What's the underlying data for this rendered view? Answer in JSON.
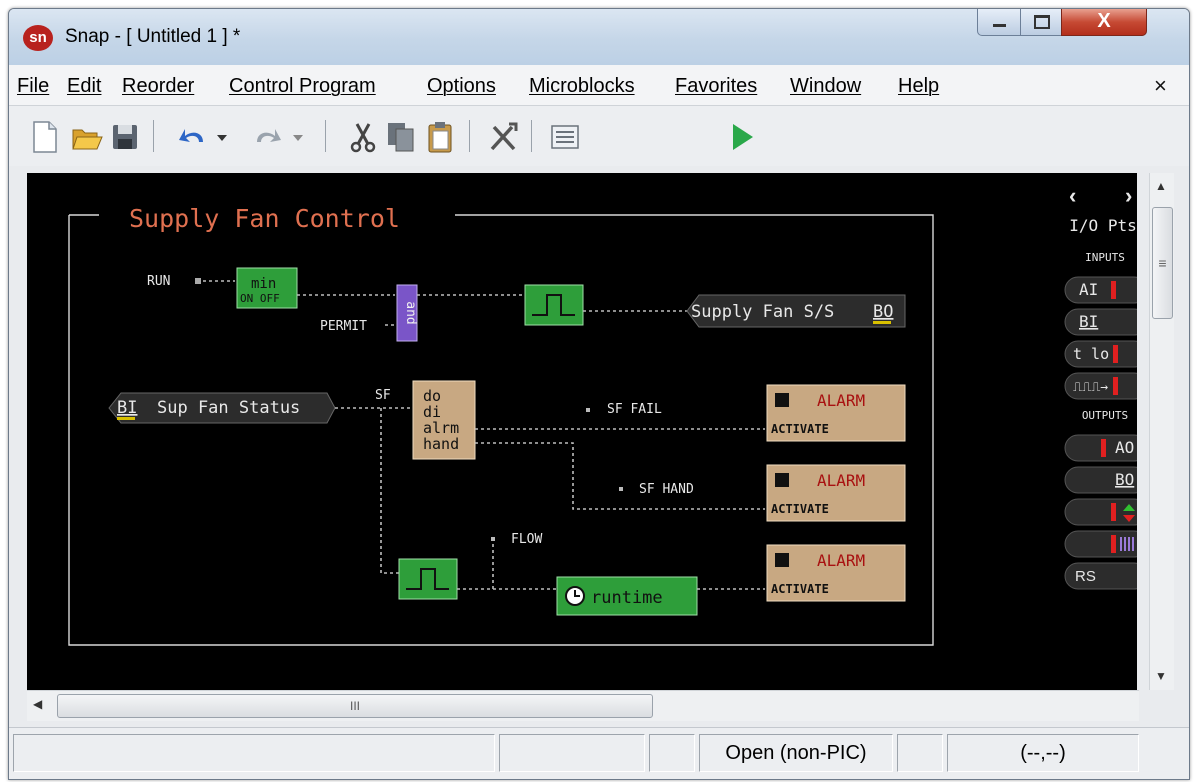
{
  "window": {
    "title": "Snap - [ Untitled 1 ] *",
    "app_icon": "sn",
    "close_glyph": "X"
  },
  "menu": {
    "items": [
      "File",
      "Edit",
      "Reorder",
      "Control Program",
      "Options",
      "Microblocks",
      "Favorites",
      "Window",
      "Help"
    ],
    "close": "×"
  },
  "toolbar": {
    "icons": [
      "new-file-icon",
      "open-folder-icon",
      "save-icon",
      "undo-icon",
      "redo-icon",
      "cut-icon",
      "copy-icon",
      "paste-icon",
      "tools-icon",
      "list-icon",
      "run-icon"
    ]
  },
  "diagram": {
    "title": "Supply Fan Control",
    "run": "RUN",
    "permit": "PERMIT",
    "min_top": "min",
    "min_bottom": "ON OFF",
    "and_label": "and",
    "supply_fan_out": "Supply Fan S/S",
    "supply_fan_out_type": "BO",
    "sf": "SF",
    "bi_type": "BI",
    "bi_name": "Sup Fan Status",
    "block_lines": [
      "do",
      "di",
      "alrm",
      "hand"
    ],
    "sf_fail": "SF FAIL",
    "sf_hand": "SF HAND",
    "flow": "FLOW",
    "runtime": "runtime",
    "alarm_label": "ALARM",
    "activate_label": "ACTIVATE"
  },
  "io_panel": {
    "prev": "‹",
    "next": "›",
    "title": "I/O Pts",
    "inputs_header": "INPUTS",
    "inputs": [
      "AI",
      "BI",
      "t lo",
      "⎍⎍⎍→"
    ],
    "outputs_header": "OUTPUTS",
    "outputs": [
      "AO",
      "BO",
      "",
      "",
      "RS"
    ]
  },
  "hscroll": {
    "thumb_grip": "III"
  },
  "vscroll": {
    "thumb_grip": "≡"
  },
  "status": {
    "mode": "Open (non-PIC)",
    "coords": "(--,--)"
  },
  "colors": {
    "alarm_text": "#a81010",
    "wire": "#c8c8c8",
    "title": "#e07050",
    "green_block": "#2e9e3a",
    "purple_block": "#7a55c8",
    "tan_block": "#c8a882"
  }
}
